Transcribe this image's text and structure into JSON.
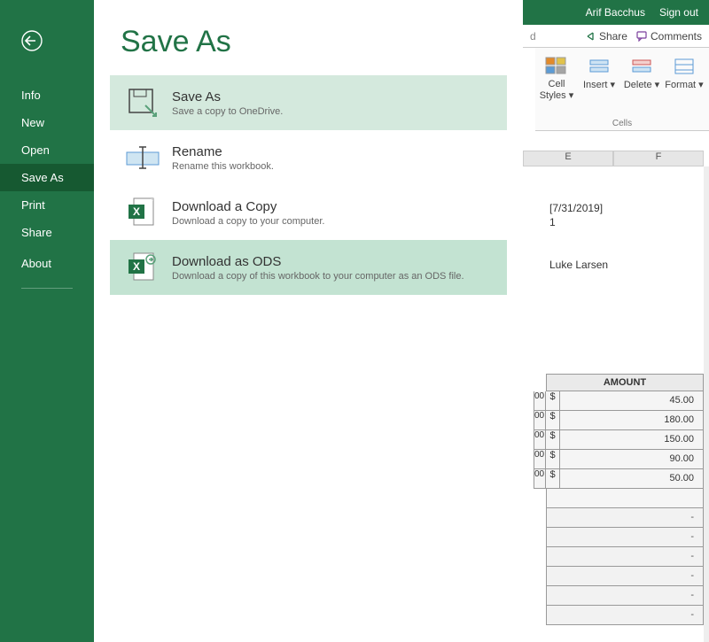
{
  "account": {
    "username": "Arif Bacchus",
    "signout": "Sign out"
  },
  "partial_letter": "d",
  "ribbon": {
    "share": "Share",
    "comments": "Comments",
    "buttons": [
      {
        "label": "Cell Styles ▾",
        "name": "cell-styles-button"
      },
      {
        "label": "Insert ▾",
        "name": "insert-button"
      },
      {
        "label": "Delete ▾",
        "name": "delete-button"
      },
      {
        "label": "Format ▾",
        "name": "format-button"
      }
    ],
    "group_label": "Cells"
  },
  "sidebar": {
    "items": [
      {
        "label": "Info",
        "name": "nav-info",
        "active": false
      },
      {
        "label": "New",
        "name": "nav-new",
        "active": false
      },
      {
        "label": "Open",
        "name": "nav-open",
        "active": false
      },
      {
        "label": "Save As",
        "name": "nav-save-as",
        "active": true
      },
      {
        "label": "Print",
        "name": "nav-print",
        "active": false
      },
      {
        "label": "Share",
        "name": "nav-share",
        "active": false
      },
      {
        "label": "About",
        "name": "nav-about",
        "active": false,
        "divider_after": true
      }
    ]
  },
  "page": {
    "title": "Save As"
  },
  "options": [
    {
      "name": "option-save-as",
      "title": "Save As",
      "desc": "Save a copy to OneDrive.",
      "icon": "floppy",
      "state": "highlight"
    },
    {
      "name": "option-rename",
      "title": "Rename",
      "desc": "Rename this workbook.",
      "icon": "rename",
      "state": ""
    },
    {
      "name": "option-download-copy",
      "title": "Download a Copy",
      "desc": "Download a copy to your computer.",
      "icon": "excel",
      "state": ""
    },
    {
      "name": "option-download-ods",
      "title": "Download as ODS",
      "desc": "Download a copy of this workbook to your computer as an ODS file.",
      "icon": "excel-arrow",
      "state": "hover"
    }
  ],
  "sheet": {
    "columns": [
      "E",
      "F"
    ],
    "cells": {
      "date": "[7/31/2019]",
      "number": "1",
      "name": "Luke Larsen"
    },
    "amount_header": "AMOUNT",
    "row_truncated": "00",
    "rows": [
      {
        "currency": "$",
        "value": "45.00"
      },
      {
        "currency": "$",
        "value": "180.00"
      },
      {
        "currency": "$",
        "value": "150.00"
      },
      {
        "currency": "$",
        "value": "90.00"
      },
      {
        "currency": "$",
        "value": "50.00"
      }
    ],
    "dash_rows": [
      "-",
      "-",
      "-",
      "-",
      "-",
      "-"
    ]
  }
}
